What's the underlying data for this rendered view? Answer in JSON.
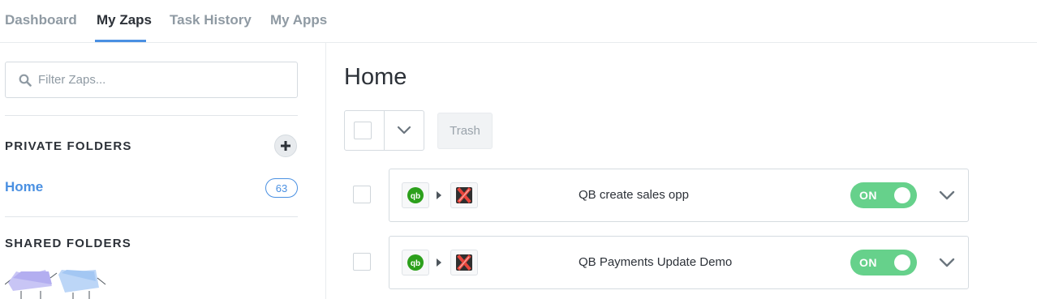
{
  "nav": {
    "tabs": [
      "Dashboard",
      "My Zaps",
      "Task History",
      "My Apps"
    ],
    "active_tab": "My Zaps"
  },
  "sidebar": {
    "search": {
      "placeholder": "Filter Zaps...",
      "value": "",
      "icon": "search-icon"
    },
    "private_folders": {
      "title": "PRIVATE FOLDERS",
      "add_icon": "plus-icon",
      "folders": [
        {
          "label": "Home",
          "count": "63"
        }
      ]
    },
    "shared_folders": {
      "title": "SHARED FOLDERS"
    }
  },
  "main": {
    "title": "Home",
    "toolbar": {
      "trash_label": "Trash"
    },
    "zaps": [
      {
        "name": "QB create sales opp",
        "trigger_app": "quickbooks-icon",
        "action_app": "x-app-icon",
        "status": "ON"
      },
      {
        "name": "QB Payments Update Demo",
        "trigger_app": "quickbooks-icon",
        "action_app": "x-app-icon",
        "status": "ON"
      }
    ]
  },
  "colors": {
    "accent": "#4a90e2",
    "toggle_on": "#66d18b",
    "quickbooks_green": "#2ca01c",
    "action_app_red": "#e8453c"
  }
}
